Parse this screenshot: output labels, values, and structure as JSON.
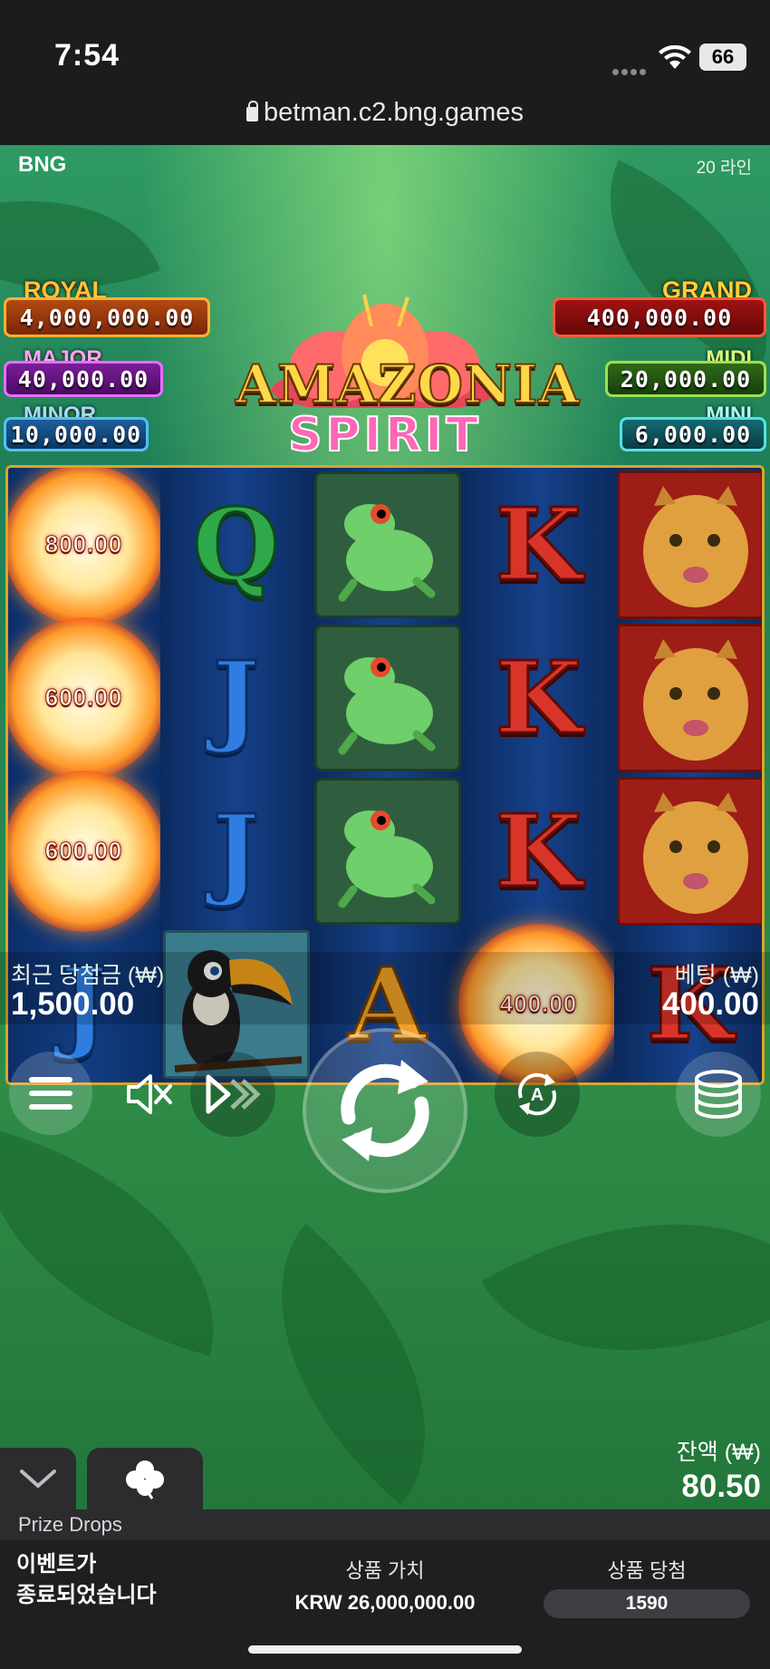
{
  "status_bar": {
    "time": "7:54",
    "battery": "66"
  },
  "browser": {
    "url": "betman.c2.bng.games"
  },
  "game": {
    "brand": "BNG",
    "lines": "20 라인",
    "logo": {
      "line1": "AMAZONIA",
      "line2": "SPIRIT"
    },
    "jackpots": {
      "royal": {
        "label": "ROYAL",
        "value": "4,000,000.00"
      },
      "major": {
        "label": "MAJOR",
        "value": "40,000.00"
      },
      "minor": {
        "label": "MINOR",
        "value": "10,000.00"
      },
      "grand": {
        "label": "GRAND",
        "value": "400,000.00"
      },
      "midi": {
        "label": "MIDI",
        "value": "20,000.00"
      },
      "mini": {
        "label": "MINI",
        "value": "6,000.00"
      }
    },
    "reels": {
      "r1": {
        "s1": "800.00",
        "s2": "600.00",
        "s3": "600.00",
        "s4": "J"
      },
      "r2": {
        "s1": "Q",
        "s2": "J",
        "s3": "J"
      },
      "r3": {
        "s4": "A"
      },
      "r4": {
        "s1": "K",
        "s2": "K",
        "s3": "K",
        "s4": "400.00"
      },
      "r5": {
        "s4": "K"
      }
    },
    "last_win_label": "최근 당첨금 (₩)",
    "last_win_value": "1,500.00",
    "bet_label": "베팅 (₩)",
    "bet_value": "400.00",
    "balance_label": "잔액 (₩)",
    "balance_value": "80.50",
    "auto_letter": "A"
  },
  "prize_drops": {
    "title": "Prize Drops",
    "status": "이벤트가\n종료되었습니다",
    "value_label": "상품 가치",
    "value": "KRW 26,000,000.00",
    "wins_label": "상품 당첨",
    "wins": "1590"
  },
  "colors": {
    "reel_frame": "#d9a52a",
    "accent_green": "#2e8c47"
  }
}
